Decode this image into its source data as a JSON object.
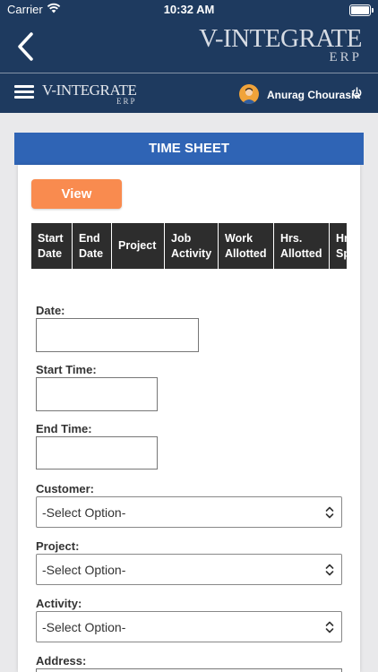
{
  "status_bar": {
    "carrier": "Carrier",
    "time": "10:32 AM"
  },
  "header": {
    "brand_main": "V-INTEGRATE",
    "brand_sub": "ERP",
    "user_name": "Anurag Chourasia"
  },
  "timesheet": {
    "title": "TIME SHEET",
    "view_button": "View",
    "columns": [
      {
        "label": "Start Date"
      },
      {
        "label": "End Date"
      },
      {
        "label": "Project"
      },
      {
        "label": "Job Activity"
      },
      {
        "label": "Work Allotted"
      },
      {
        "label": "Hrs. Allotted"
      },
      {
        "label": "Hrs. Spent"
      }
    ]
  },
  "form": {
    "date_label": "Date:",
    "date_value": "",
    "start_time_label": "Start Time:",
    "start_time_value": "",
    "end_time_label": "End Time:",
    "end_time_value": "",
    "customer_label": "Customer:",
    "customer_selected": "-Select Option-",
    "project_label": "Project:",
    "project_selected": "-Select Option-",
    "activity_label": "Activity:",
    "activity_selected": "-Select Option-",
    "address_label": "Address:"
  }
}
